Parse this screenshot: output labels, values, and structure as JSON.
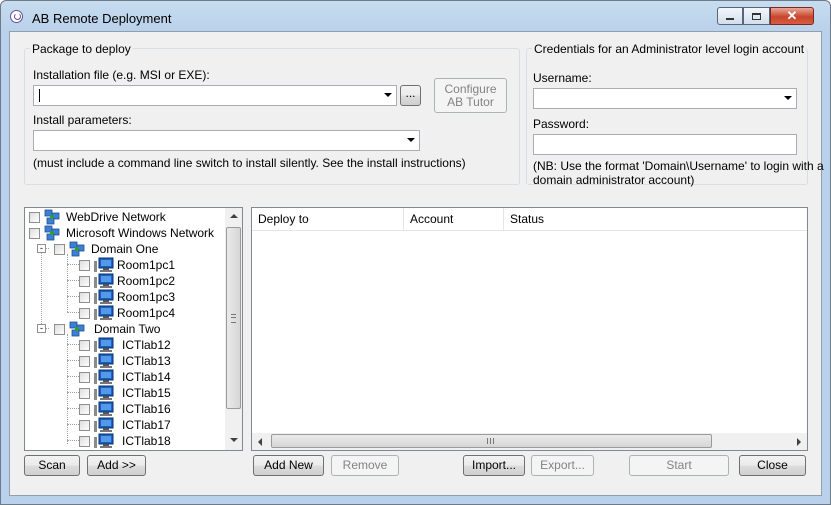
{
  "window": {
    "title": "AB Remote Deployment"
  },
  "package": {
    "legend": "Package to deploy",
    "install_file_label": "Installation file (e.g. MSI or EXE):",
    "install_file_value": "",
    "browse_label": "...",
    "configure_label": "Configure AB Tutor",
    "params_label": "Install parameters:",
    "params_value": "",
    "note": "(must include a command line switch to install silently. See the install instructions)"
  },
  "credentials": {
    "legend": "Credentials for an Administrator level login account",
    "username_label": "Username:",
    "username_value": "",
    "password_label": "Password:",
    "password_value": "",
    "note_line1": "(NB: Use the format 'Domain\\Username' to login with a",
    "note_line2": "domain administrator account)"
  },
  "tree": {
    "nodes": [
      {
        "label": "WebDrive Network",
        "type": "network"
      },
      {
        "label": "Microsoft Windows Network",
        "type": "network"
      },
      {
        "label": "Domain One",
        "type": "domain"
      },
      {
        "label": "Room1pc1",
        "type": "computer"
      },
      {
        "label": "Room1pc2",
        "type": "computer"
      },
      {
        "label": "Room1pc3",
        "type": "computer"
      },
      {
        "label": "Room1pc4",
        "type": "computer"
      },
      {
        "label": "Domain Two",
        "type": "domain"
      },
      {
        "label": "ICTlab12",
        "type": "computer"
      },
      {
        "label": "ICTlab13",
        "type": "computer"
      },
      {
        "label": "ICTlab14",
        "type": "computer"
      },
      {
        "label": "ICTlab15",
        "type": "computer"
      },
      {
        "label": "ICTlab16",
        "type": "computer"
      },
      {
        "label": "ICTlab17",
        "type": "computer"
      },
      {
        "label": "ICTlab18",
        "type": "computer"
      }
    ]
  },
  "deploy_list": {
    "columns": [
      "Deploy to",
      "Account",
      "Status"
    ],
    "rows": []
  },
  "buttons": {
    "scan": "Scan",
    "add": "Add >>",
    "add_new": "Add New",
    "remove": "Remove",
    "import": "Import...",
    "export": "Export...",
    "start": "Start",
    "close": "Close"
  },
  "icons": {
    "app": "ab-tutor-icon",
    "network": "network-icon",
    "domain": "domain-icon",
    "computer": "computer-icon"
  }
}
